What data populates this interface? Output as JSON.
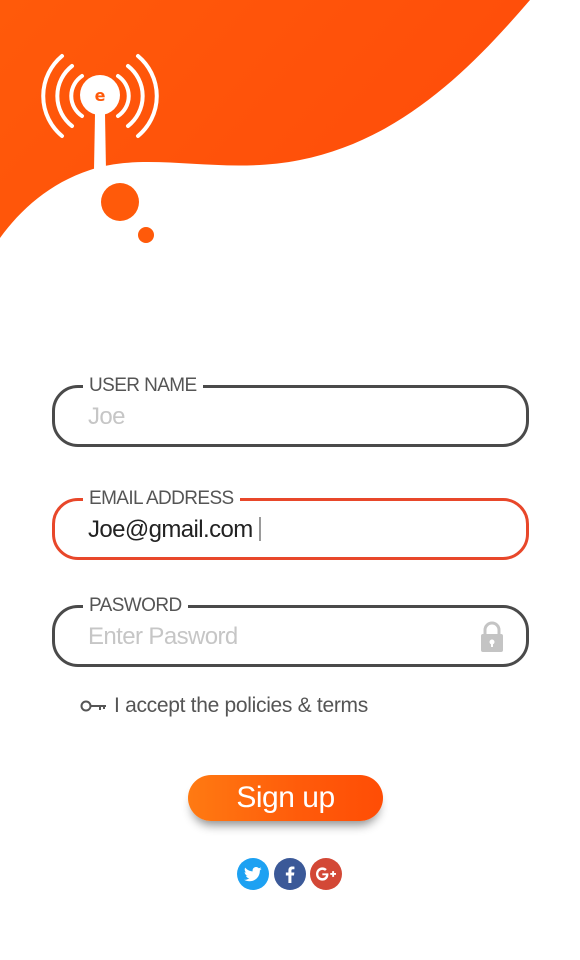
{
  "colors": {
    "brand_orange": "#ff5a0a",
    "active_border": "#e8472a",
    "twitter": "#1da1f2",
    "facebook": "#3b5998",
    "google_plus": "#d34836"
  },
  "header": {
    "logo_icon": "broadcast-antenna-icon"
  },
  "form": {
    "username": {
      "label": "USER NAME",
      "placeholder": "Joe"
    },
    "email": {
      "label": "EMAIL ADDRESS",
      "value": "Joe@gmail.com"
    },
    "password": {
      "label": "PASWORD",
      "placeholder": "Enter Pasword",
      "icon": "lock-icon"
    },
    "terms": {
      "icon": "key-icon",
      "text": "I accept the policies & terms"
    },
    "submit_label": "Sign up"
  },
  "social": {
    "items": [
      {
        "name": "twitter",
        "icon": "twitter-icon"
      },
      {
        "name": "facebook",
        "icon": "facebook-icon"
      },
      {
        "name": "google-plus",
        "icon": "google-plus-icon"
      }
    ]
  }
}
